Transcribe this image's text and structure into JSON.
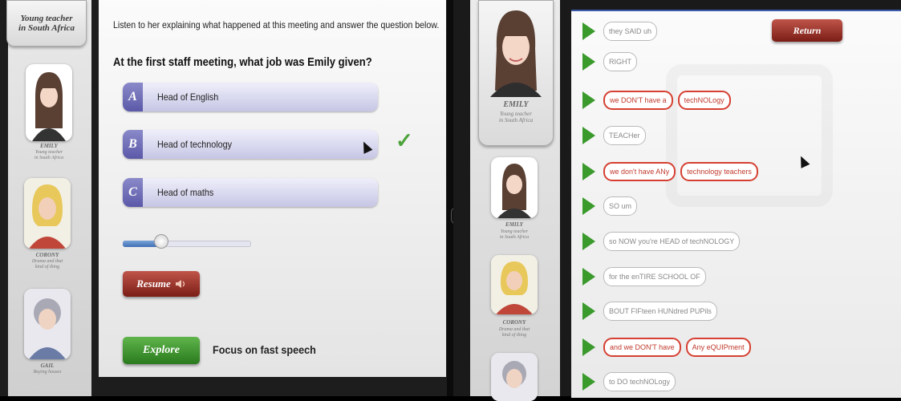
{
  "left_panel": {
    "sidebar": {
      "brand": [
        "Young teacher",
        "in South Africa"
      ],
      "people": [
        {
          "name": "EMILY",
          "desc": [
            "Young teacher",
            "in South Africa"
          ]
        },
        {
          "name": "CORONY",
          "desc": [
            "Drama and that",
            "kind of thing"
          ]
        },
        {
          "name": "GAIL",
          "desc": [
            "Buying houses"
          ]
        }
      ]
    },
    "instruction": "Listen to her explaining what happened at this meeting and answer the question below.",
    "question": "At the first staff meeting, what job was Emily given?",
    "options": [
      {
        "letter": "A",
        "text": "Head of English"
      },
      {
        "letter": "B",
        "text": "Head of technology"
      },
      {
        "letter": "C",
        "text": "Head of maths"
      }
    ],
    "correct_mark": "✓",
    "slider_progress": 0.3,
    "resume_label": "Resume",
    "explore_label": "Explore",
    "focus_text": "Focus on fast speech"
  },
  "right_panel": {
    "card": {
      "name": "EMILY",
      "desc": [
        "Young teacher",
        "in South Africa"
      ]
    },
    "return_label": "Return",
    "transcript": [
      {
        "chunks": [
          {
            "text": "they SAID uh",
            "highlight": false
          }
        ]
      },
      {
        "chunks": [
          {
            "text": "RIGHT",
            "highlight": false
          }
        ]
      },
      {
        "chunks": [
          {
            "text": "we DON'T have a",
            "highlight": true
          },
          {
            "text": "techNOLogy",
            "highlight": true
          }
        ]
      },
      {
        "chunks": [
          {
            "text": "TEACHer",
            "highlight": false
          }
        ]
      },
      {
        "chunks": [
          {
            "text": "we don't have ANy",
            "highlight": true
          },
          {
            "text": "technology teachers",
            "highlight": true
          }
        ]
      },
      {
        "chunks": [
          {
            "text": "SO um",
            "highlight": false
          }
        ]
      },
      {
        "chunks": [
          {
            "text": "so NOW you're HEAD of techNOLOGY",
            "highlight": false
          }
        ]
      },
      {
        "chunks": [
          {
            "text": "for the enTIRE SCHOOL OF",
            "highlight": false
          }
        ]
      },
      {
        "chunks": [
          {
            "text": "BOUT FIFteen HUNdred PUPils",
            "highlight": false
          }
        ]
      },
      {
        "chunks": [
          {
            "text": "and we DON'T have",
            "highlight": true
          },
          {
            "text": "Any eQUIPment",
            "highlight": true
          }
        ]
      },
      {
        "chunks": [
          {
            "text": "to DO techNOLogy",
            "highlight": false
          }
        ]
      }
    ]
  },
  "colors": {
    "accent_purple": "#5b59a8",
    "check_green": "#4ca33a",
    "play_green": "#3a9a2c",
    "highlight_red": "#d54032"
  }
}
